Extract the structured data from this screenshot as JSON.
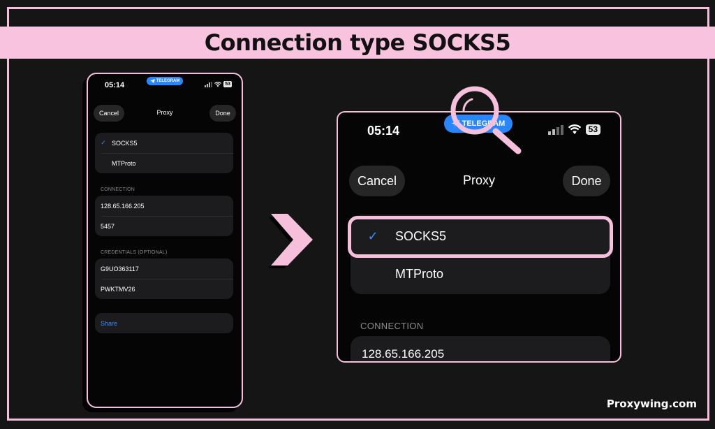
{
  "banner": {
    "title": "Connection type SOCKS5"
  },
  "phone": {
    "status": {
      "time": "05:14",
      "app_pill": "TELEGRAM",
      "battery": "53"
    },
    "nav": {
      "cancel": "Cancel",
      "title": "Proxy",
      "done": "Done"
    },
    "types": [
      {
        "label": "SOCKS5",
        "selected": true
      },
      {
        "label": "MTProto",
        "selected": false
      }
    ],
    "connection": {
      "section": "CONNECTION",
      "server": "128.65.166.205",
      "port": "5457"
    },
    "credentials": {
      "section": "CREDENTIALS (OPTIONAL)",
      "username": "G9UO363117",
      "password": "PWKTMV26"
    },
    "share": "Share"
  },
  "zoom": {
    "status": {
      "time": "05:14",
      "app_pill": "TELEGRAM",
      "battery": "53"
    },
    "nav": {
      "cancel": "Cancel",
      "title": "Proxy",
      "done": "Done"
    },
    "types": [
      {
        "label": "SOCKS5",
        "selected": true
      },
      {
        "label": "MTProto",
        "selected": false
      }
    ],
    "connection": {
      "section": "CONNECTION",
      "server": "128.65.166.205"
    }
  },
  "brand": "Proxywing.com",
  "colors": {
    "accent_pink": "#f6bfdc",
    "ios_blue": "#2a86ff",
    "background": "#151515"
  }
}
